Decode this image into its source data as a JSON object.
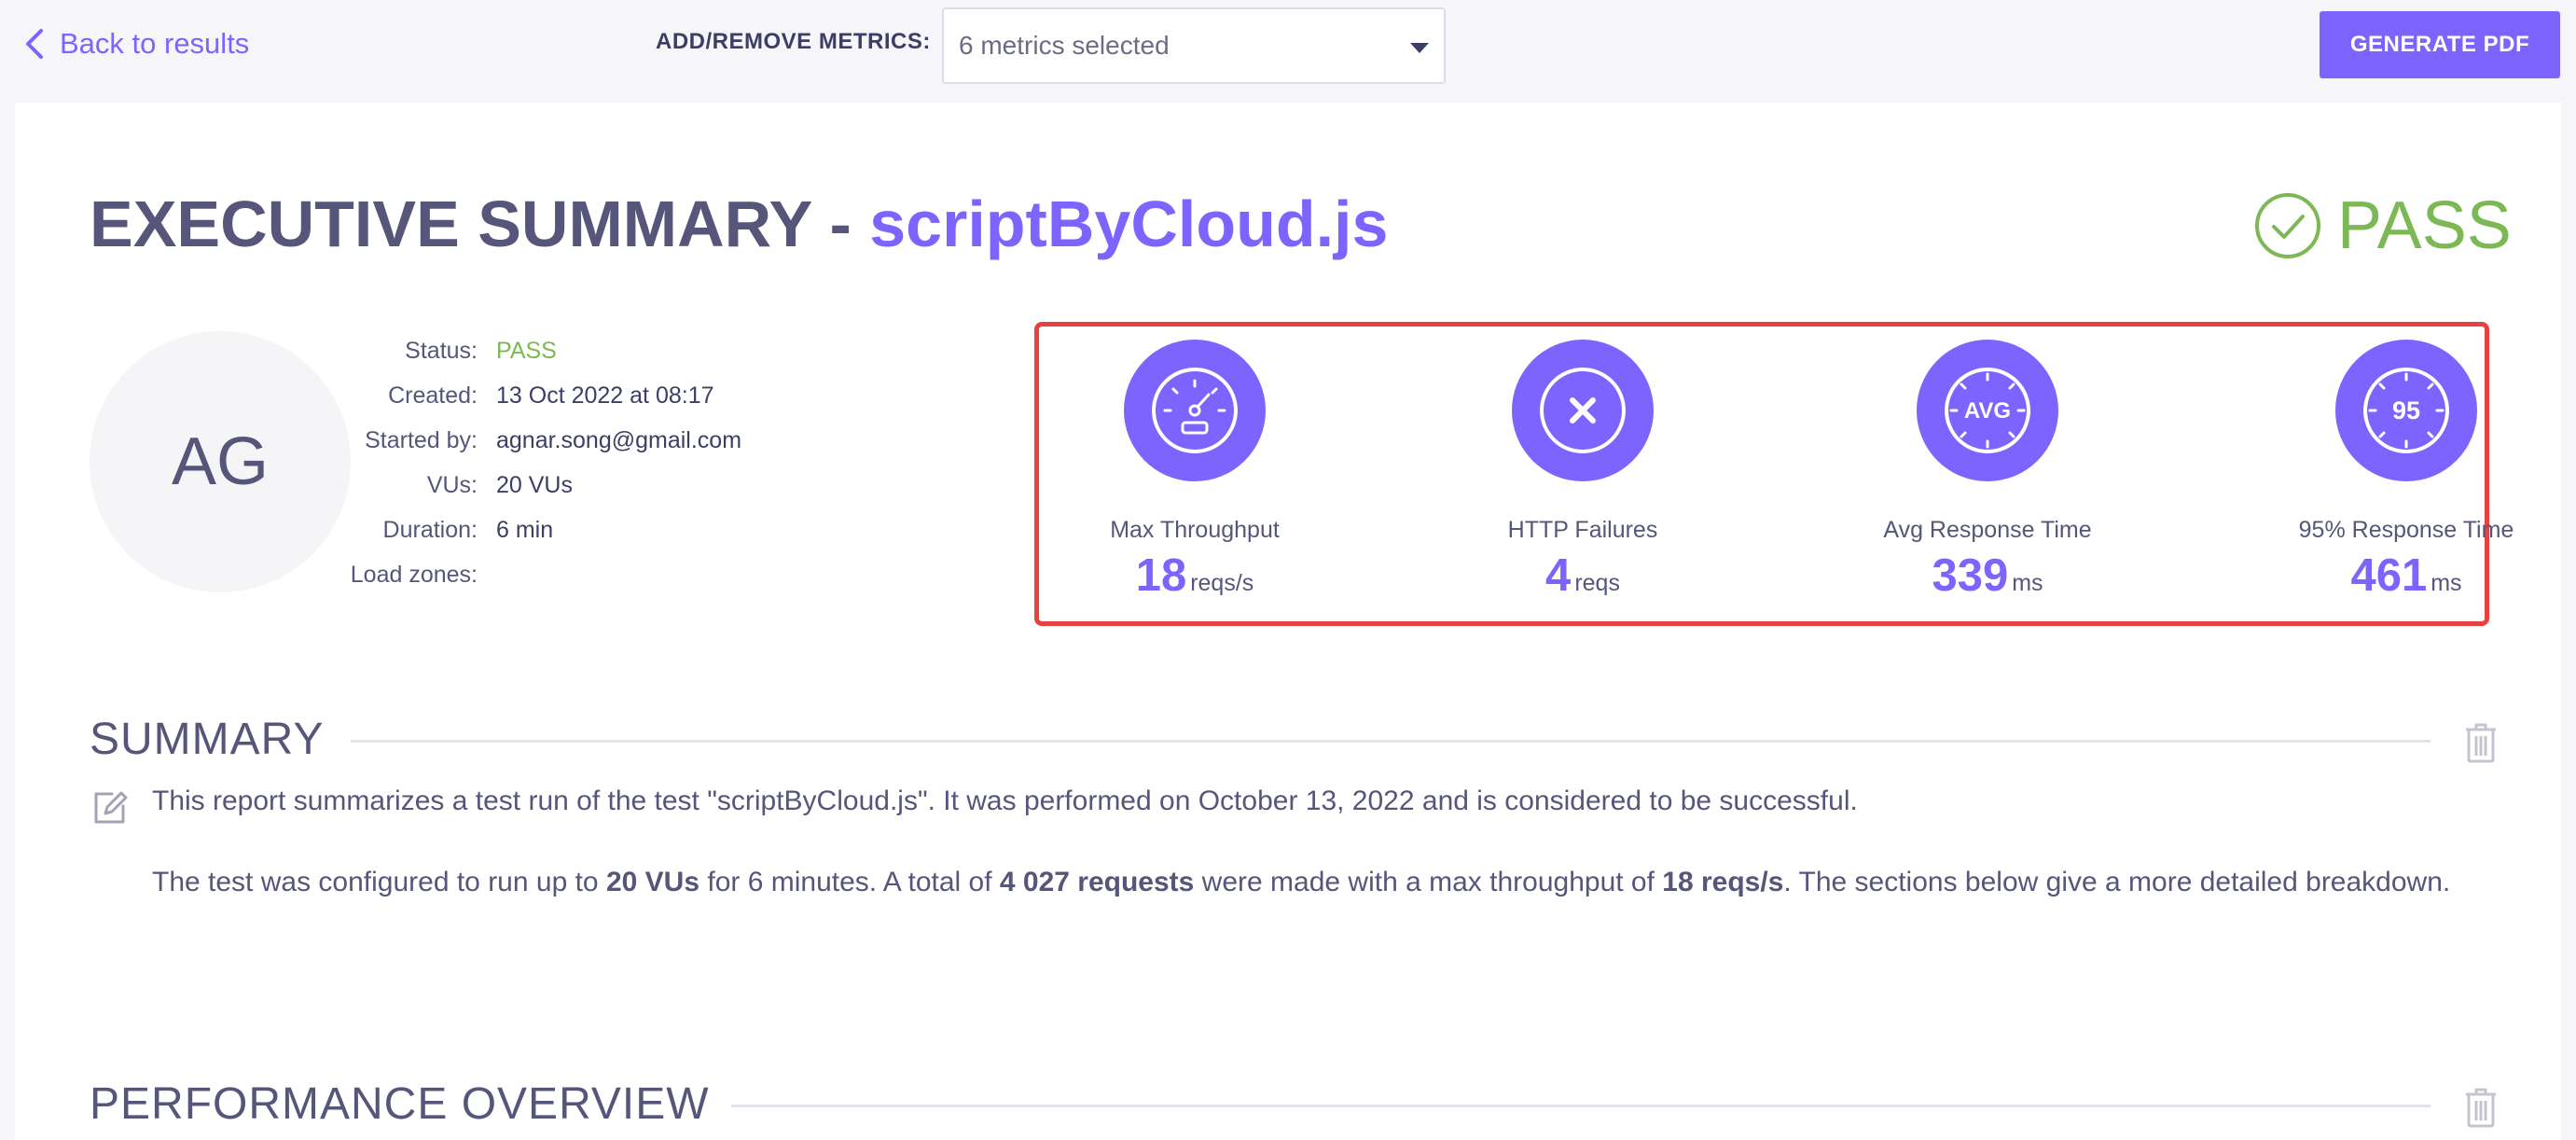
{
  "topbar": {
    "back_label": "Back to results",
    "metrics_label": "ADD/REMOVE METRICS:",
    "metrics_selected": "6 metrics selected",
    "pdf_label": "GENERATE PDF"
  },
  "header": {
    "title_prefix": "EXECUTIVE SUMMARY - ",
    "script_name": "scriptByCloud.js",
    "result": "PASS"
  },
  "avatar": {
    "initials": "AG"
  },
  "info": [
    {
      "key": "Status:",
      "value": "PASS"
    },
    {
      "key": "Created:",
      "value": "13 Oct 2022 at 08:17"
    },
    {
      "key": "Started by:",
      "value": "agnar.song@gmail.com"
    },
    {
      "key": "VUs:",
      "value": "20 VUs"
    },
    {
      "key": "Duration:",
      "value": "6 min"
    },
    {
      "key": "Load zones:",
      "value": ""
    }
  ],
  "metrics": [
    {
      "label": "Max Throughput",
      "value": "18",
      "unit": "reqs/s",
      "icon": "speedometer-icon"
    },
    {
      "label": "HTTP Failures",
      "value": "4",
      "unit": "reqs",
      "icon": "x-circle-icon"
    },
    {
      "label": "Avg Response Time",
      "value": "339",
      "unit": "ms",
      "icon": "avg-gauge-icon",
      "icon_text": "AVG"
    },
    {
      "label": "95% Response Time",
      "value": "461",
      "unit": "ms",
      "icon": "percentile-gauge-icon",
      "icon_text": "95"
    }
  ],
  "summary": {
    "title": "SUMMARY",
    "p1": "This report summarizes a test run of the test \"scriptByCloud.js\". It was performed on October 13, 2022 and is considered to be successful.",
    "p2_a": "The test was configured to run up to ",
    "p2_vus": "20 VUs",
    "p2_b": " for 6 minutes. A total of ",
    "p2_requests": "4 027 requests",
    "p2_c": " were made with a max throughput of ",
    "p2_throughput": "18 reqs/s",
    "p2_d": ". The sections below give a more detailed breakdown."
  },
  "performance": {
    "title": "PERFORMANCE OVERVIEW"
  },
  "colors": {
    "accent": "#7d64ff",
    "pass": "#7cb854",
    "highlight_border": "#e8413f",
    "text": "#55567a"
  }
}
